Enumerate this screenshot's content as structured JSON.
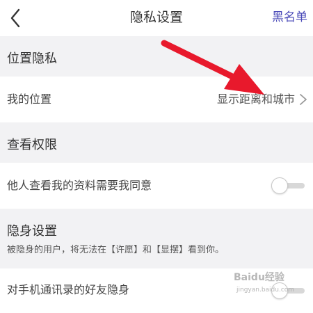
{
  "header": {
    "title": "隐私设置",
    "right_action": "黑名单",
    "back_icon": "chevron-left-icon"
  },
  "sections": [
    {
      "title": "位置隐私",
      "rows": [
        {
          "label": "我的位置",
          "value": "显示距离和城市",
          "icon": "chevron-right-icon"
        }
      ]
    },
    {
      "title": "查看权限",
      "rows": [
        {
          "label": "他人查看我的资料需要我同意",
          "toggle_on": false
        }
      ]
    },
    {
      "title": "隐身设置",
      "description": "被隐身的用户，将无法在【许愿】和【显摆】看到你。",
      "rows": [
        {
          "label": "对手机通讯录的好友隐身",
          "toggle_on": false
        }
      ]
    }
  ],
  "annotation": {
    "color": "#e8192c",
    "icon": "red-arrow-annotation"
  },
  "watermark": {
    "text": "Baidu经验",
    "subtext": "jingyan.baidu.com"
  },
  "colors": {
    "accent": "#4a4ab8",
    "background": "#f2f2f4",
    "toggle_track": "#d8d8d8"
  }
}
